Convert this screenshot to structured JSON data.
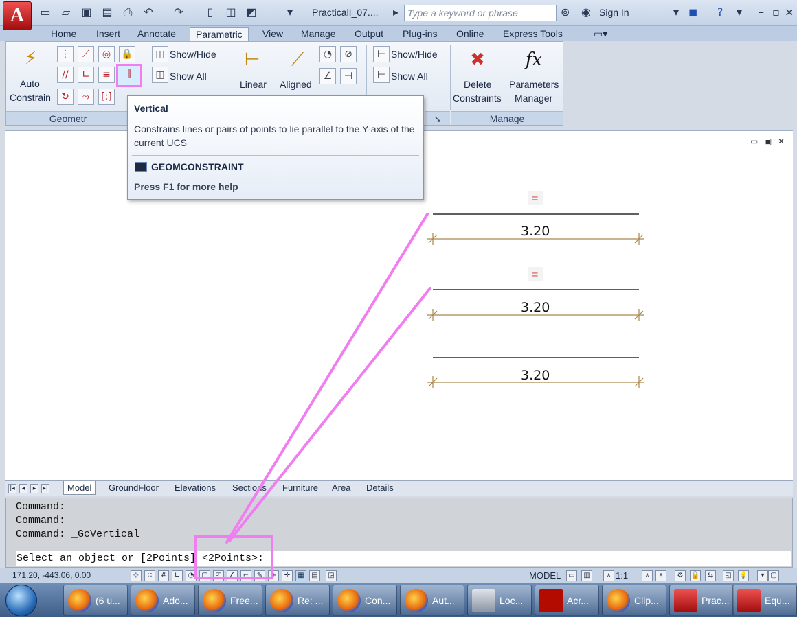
{
  "titlebar": {
    "app_button": "A",
    "document_title": "PracticalI_07....",
    "search_placeholder": "Type a keyword or phrase",
    "sign_in": "Sign In"
  },
  "ribbon_tabs": [
    "Home",
    "Insert",
    "Annotate",
    "Parametric",
    "View",
    "Manage",
    "Output",
    "Plug-ins",
    "Online",
    "Express Tools"
  ],
  "active_tab": "Parametric",
  "ribbon": {
    "auto_constrain_line1": "Auto",
    "auto_constrain_line2": "Constrain",
    "geometric_panel": "Geometr",
    "show_hide_1": "Show/Hide",
    "show_all_1": "Show All",
    "linear": "Linear",
    "aligned": "Aligned",
    "show_hide_2": "Show/Hide",
    "show_all_2": "Show All",
    "delete_line1": "Delete",
    "delete_line2": "Constraints",
    "params_line1": "Parameters",
    "params_line2": "Manager",
    "manage_panel": "Manage",
    "fx_icon": "fx"
  },
  "tooltip": {
    "title": "Vertical",
    "description": "Constrains lines or pairs of points to lie parallel to the Y-axis of the current UCS",
    "command": "GEOMCONSTRAINT",
    "help": "Press F1 for more help"
  },
  "drawing": {
    "equal_symbol": "=",
    "dimensions": [
      "3.20",
      "3.20",
      "3.20"
    ]
  },
  "layout_tabs": [
    "Model",
    "GroundFloor",
    "Elevations",
    "Sections",
    "Furniture",
    "Area",
    "Details"
  ],
  "command_window": {
    "history": [
      "Command:",
      "Command:",
      "Command: _GcVertical"
    ],
    "prompt": "Select an object or [2Points] <2Points>:"
  },
  "statusbar": {
    "coordinates": "171.20, -443.06, 0.00",
    "model": "MODEL",
    "scale": "1:1"
  },
  "taskbar": [
    {
      "label": "(6 u...",
      "icon": "firefox"
    },
    {
      "label": "Ado...",
      "icon": "firefox"
    },
    {
      "label": "Free...",
      "icon": "firefox"
    },
    {
      "label": "Re: ...",
      "icon": "firefox"
    },
    {
      "label": "Con...",
      "icon": "firefox"
    },
    {
      "label": "Aut...",
      "icon": "firefox"
    },
    {
      "label": "Loc...",
      "icon": "drive"
    },
    {
      "label": "Acr...",
      "icon": "adobe"
    },
    {
      "label": "Clip...",
      "icon": "firefox"
    },
    {
      "label": "Prac...",
      "icon": "acad"
    },
    {
      "label": "Equ...",
      "icon": "acad"
    }
  ],
  "colors": {
    "annotation_magenta": "#f07ef0",
    "dimension_line": "#a8884a",
    "constraint_red": "#d9534f"
  }
}
